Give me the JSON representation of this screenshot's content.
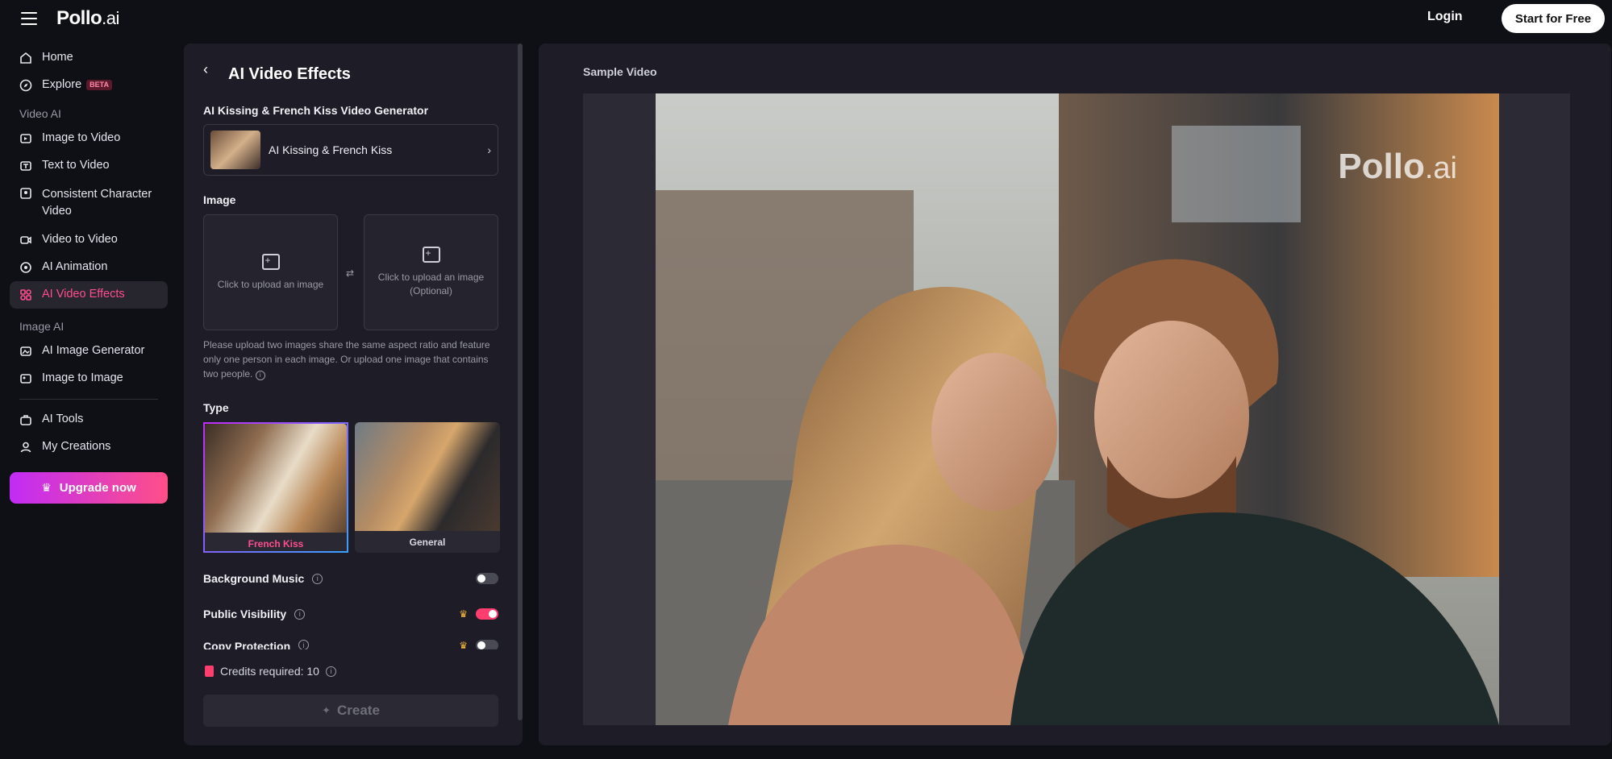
{
  "topbar": {
    "logo_main": "Pollo",
    "logo_sub": ".ai",
    "login": "Login",
    "start": "Start for Free"
  },
  "sidebar": {
    "home": "Home",
    "explore": "Explore",
    "explore_badge": "BETA",
    "section_video": "Video AI",
    "image_to_video": "Image to Video",
    "text_to_video": "Text to Video",
    "consistent_character": "Consistent Character Video",
    "video_to_video": "Video to Video",
    "ai_animation": "AI Animation",
    "ai_video_effects": "AI Video Effects",
    "section_image": "Image AI",
    "ai_image_generator": "AI Image Generator",
    "image_to_image": "Image to Image",
    "ai_tools": "AI Tools",
    "my_creations": "My Creations",
    "upgrade": "Upgrade now"
  },
  "panel": {
    "title": "AI Video Effects",
    "generator_label": "AI Kissing & French Kiss Video Generator",
    "effect_name": "AI Kissing & French Kiss",
    "image_label": "Image",
    "upload1": "Click to upload an image",
    "upload2_line1": "Click to upload an image",
    "upload2_line2": "(Optional)",
    "hint": "Please upload two images share the same aspect ratio and feature only one person in each image. Or upload one image that contains two people.",
    "type_label": "Type",
    "types": [
      {
        "label": "French Kiss",
        "color": "#ff4d8d"
      },
      {
        "label": "General",
        "color": "#d8d8e2"
      }
    ],
    "background_music": "Background Music",
    "public_visibility": "Public Visibility",
    "copy_protection": "Copy Protection",
    "credits": "Credits required: 10",
    "create": "Create"
  },
  "sample": {
    "title": "Sample Video",
    "watermark_main": "Pollo",
    "watermark_sub": ".ai"
  }
}
